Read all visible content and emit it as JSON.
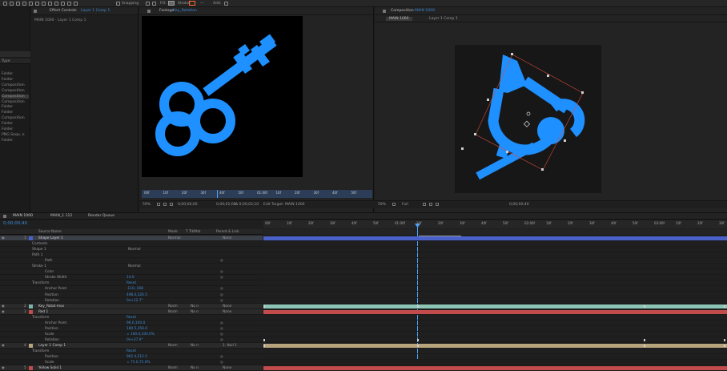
{
  "topbar": {
    "snapping_label": "Snapping",
    "fill_label": "Fill:",
    "stroke_label": "Stroke:",
    "add_label": "Add:"
  },
  "project": {
    "col_type": "Type",
    "items": [
      "Folder",
      "Folder",
      "Composition",
      "Composition",
      "Composition",
      "Composition",
      "Folder",
      "Folder",
      "Composition",
      "Folder",
      "Folder",
      "PNG Sequ..e",
      "Folder"
    ]
  },
  "effect_controls": {
    "title": "Effect Controls",
    "layer": "Layer 1 Comp 1",
    "breadcrumb": "MAIN 1000 · Layer 1 Comp 1"
  },
  "footage": {
    "title": "Footage",
    "file": "Key_Rotation",
    "ruler": [
      "00f",
      "10f",
      "20f",
      "30f",
      "40f",
      "50f",
      "01:00f",
      "10f",
      "20f",
      "30f",
      "40f",
      "50f"
    ],
    "zoom": "59%",
    "timecode": "0;00;00;00",
    "dur1": "0;00;02;08",
    "dur2": "Δ 0;00;02;10",
    "edit_target": "Edit Target: MAIN 1000"
  },
  "composition": {
    "title": "Composition",
    "name": "MAIN 1000",
    "tabs": [
      "MAIN 1000",
      "Layer 1 Comp 1"
    ],
    "zoom": "59%",
    "resolution": "Full",
    "timecode": "0;00;00;40"
  },
  "timeline": {
    "tabs": [
      "MAIN 1000",
      "MAIN_1 112",
      "Render Queue"
    ],
    "timecode": "0;00;00;40",
    "col_source": "Source Name",
    "col_mode": "Mode",
    "col_trkmat": "T  TrkMat",
    "col_parent": "Parent & Link",
    "add_label": "Add:",
    "tooltip": "Current Time Indicator",
    "ruler": [
      "00f",
      "10f",
      "20f",
      "30f",
      "40f",
      "50f",
      "01:00f",
      "10f",
      "20f",
      "30f",
      "40f",
      "50f",
      "02:00f",
      "10f",
      "20f",
      "30f",
      "40f",
      "50f",
      "03:00f",
      "10f",
      "20f",
      "30f"
    ],
    "rows": [
      {
        "num": "1",
        "name": "Shape Layer 1",
        "mode": "Normal",
        "trk": "",
        "parent": "None",
        "kind": "layer",
        "color": "#4a61c9"
      },
      {
        "num": "",
        "name": "Contents",
        "kind": "group"
      },
      {
        "num": "",
        "name": "Shape 1",
        "mode": "Normal",
        "kind": "group"
      },
      {
        "num": "",
        "name": "Path 1",
        "kind": "group"
      },
      {
        "num": "",
        "name": "Path",
        "kind": "prop"
      },
      {
        "num": "",
        "name": "Stroke 1",
        "mode": "Normal",
        "kind": "group"
      },
      {
        "num": "",
        "name": "Color",
        "kind": "prop"
      },
      {
        "num": "",
        "name": "Stroke Width",
        "value": "14.0",
        "kind": "prop"
      },
      {
        "num": "",
        "name": "Transform",
        "value": "Reset",
        "kind": "group"
      },
      {
        "num": "",
        "name": "Anchor Point",
        "value": "-110,-168",
        "kind": "prop"
      },
      {
        "num": "",
        "name": "Position",
        "value": "498.0,326.5",
        "kind": "prop"
      },
      {
        "num": "",
        "name": "Rotation",
        "value": "0x+12.7°",
        "kind": "prop"
      },
      {
        "num": "2",
        "name": "Key_Rotat-mov",
        "mode": "Norm",
        "trk": "No n",
        "parent": "None",
        "kind": "layer",
        "color": "#7fb3a8"
      },
      {
        "num": "3",
        "name": "Red 1",
        "mode": "Norm",
        "trk": "No n",
        "parent": "None",
        "kind": "layer",
        "color": "#c24b4b"
      },
      {
        "num": "",
        "name": "Transform",
        "value": "Reset",
        "kind": "group"
      },
      {
        "num": "",
        "name": "Anchor Point",
        "value": "96.0,100.0",
        "kind": "prop"
      },
      {
        "num": "",
        "name": "Position",
        "value": "180.5,356.0",
        "kind": "prop"
      },
      {
        "num": "",
        "name": "Scale",
        "value": "∞ 100.0,100.0%",
        "kind": "prop"
      },
      {
        "num": "",
        "name": "Rotation",
        "value": "0x+37.9°",
        "kind": "prop"
      },
      {
        "num": "4",
        "name": "Layer 1 Comp 1",
        "mode": "Norm",
        "trk": "No n",
        "parent": "1. Null 1",
        "kind": "layer",
        "color": "#b8a47c"
      },
      {
        "num": "",
        "name": "Transform",
        "value": "Reset",
        "kind": "group"
      },
      {
        "num": "",
        "name": "Position",
        "value": "962.4,512.5",
        "kind": "prop"
      },
      {
        "num": "",
        "name": "Scale",
        "value": "∞ 75.0,75.0%",
        "kind": "prop"
      },
      {
        "num": "5",
        "name": "Yellow Solid 1",
        "mode": "Norm",
        "trk": "No n",
        "parent": "None",
        "kind": "layer",
        "color": "#c24b4b"
      }
    ]
  },
  "colors": {
    "accent_blue": "#1a8cff",
    "key_shape": "#1e90ff",
    "cti": "#4ba4ff",
    "bar_shape": "#4a61c9",
    "bar_teal": "#8bc5b5",
    "bar_red": "#c24b4b",
    "bar_tan": "#b8a47c"
  }
}
